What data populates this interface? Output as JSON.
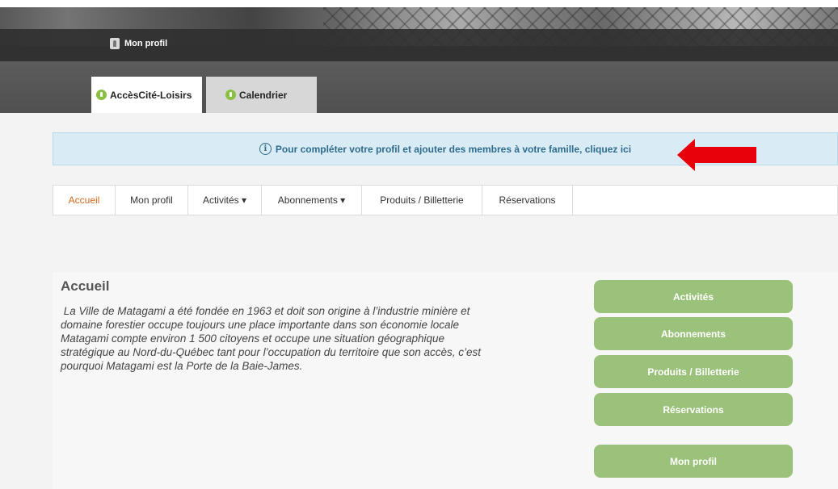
{
  "header": {
    "profile_link": "Mon profil",
    "tabs": [
      {
        "label": "AccèsCité-Loisirs"
      },
      {
        "label": "Calendrier"
      }
    ]
  },
  "info_bar": {
    "icon": "info-circle-icon",
    "text": "Pour compléter votre profil et ajouter des membres à votre famille, cliquez ici",
    "annotation": "red-arrow"
  },
  "nav": {
    "items": [
      {
        "label": "Accueil",
        "active": true
      },
      {
        "label": "Mon profil"
      },
      {
        "label": "Activités ▾"
      },
      {
        "label": "Abonnements ▾"
      },
      {
        "label": "Produits / Billetterie"
      },
      {
        "label": "Réservations"
      }
    ]
  },
  "main": {
    "title": "Accueil",
    "lines": [
      " La Ville de Matagami a été fondée en 1963 et doit son origine à l’industrie minière et",
      "domaine forestier occupe toujours une place importante dans son économie locale",
      "Matagami compte environ 1 500 citoyens et occupe une situation géographique",
      "stratégique au Nord-du-Québec tant pour l’occupation du territoire que son accès, c’est",
      "pourquoi Matagami est la Porte de la Baie-James."
    ]
  },
  "side_buttons": [
    {
      "label": "Activités"
    },
    {
      "label": "Abonnements"
    },
    {
      "label": "Produits / Billetterie"
    },
    {
      "label": "Réservations"
    },
    {
      "label": "Mon profil"
    }
  ],
  "colors": {
    "accent_green": "#9bc27a",
    "tab_icon_green": "#8ac041",
    "active_nav": "#d2671e",
    "info_text": "#2e6b8c",
    "arrow": "#e8000b"
  }
}
